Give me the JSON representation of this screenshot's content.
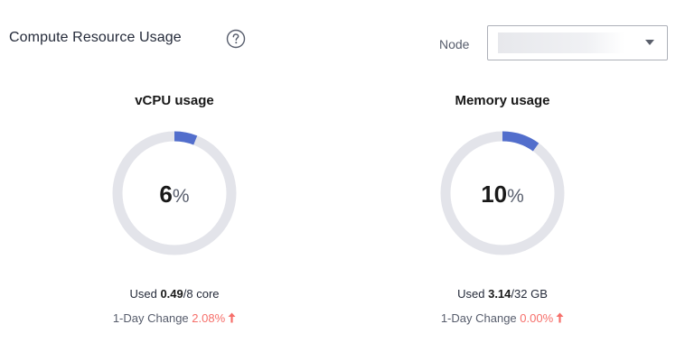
{
  "header": {
    "title": "Compute Resource Usage",
    "help_icon": "help-circle-icon"
  },
  "node_filter": {
    "label": "Node",
    "selected_value": ""
  },
  "colors": {
    "track": "#e3e4ea",
    "progress": "#526ecc",
    "increase": "#f66f6a"
  },
  "panels": [
    {
      "title": "vCPU usage",
      "percent_value": "6",
      "percent_sign": "%",
      "usage_fraction": 0.06,
      "used_label": "Used",
      "used_value": "0.49",
      "total": "/8 core",
      "change_label": "1-Day Change",
      "change_value": "2.08%",
      "change_icon": "arrow-up-icon"
    },
    {
      "title": "Memory usage",
      "percent_value": "10",
      "percent_sign": "%",
      "usage_fraction": 0.1,
      "used_label": "Used",
      "used_value": "3.14",
      "total": "/32 GB",
      "change_label": "1-Day Change",
      "change_value": "0.00%",
      "change_icon": "arrow-up-icon"
    }
  ]
}
